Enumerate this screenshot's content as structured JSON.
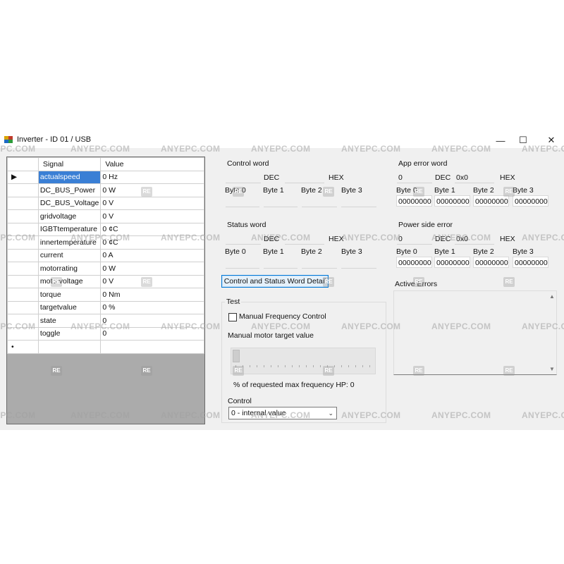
{
  "window": {
    "title": "Inverter - ID 01 / USB",
    "controls": {
      "minimize": "—",
      "maximize": "☐",
      "close": "✕"
    }
  },
  "grid": {
    "headers": {
      "signal": "Signal",
      "value": "Value"
    },
    "rows": [
      {
        "signal": "actualspeed",
        "value": "0 Hz"
      },
      {
        "signal": "DC_BUS_Power",
        "value": "0 W"
      },
      {
        "signal": "DC_BUS_Voltage",
        "value": "0 V"
      },
      {
        "signal": "gridvoltage",
        "value": "0 V"
      },
      {
        "signal": "IGBTtemperature",
        "value": "0 ¢C"
      },
      {
        "signal": "innertemperature",
        "value": "0 ¢C"
      },
      {
        "signal": "current",
        "value": "0 A"
      },
      {
        "signal": "motorrating",
        "value": "0 W"
      },
      {
        "signal": "motorvoltage",
        "value": "0 V"
      },
      {
        "signal": "torque",
        "value": "0 Nm"
      },
      {
        "signal": "targetvalue",
        "value": "0 %"
      },
      {
        "signal": "state",
        "value": "0"
      },
      {
        "signal": "toggle",
        "value": "0"
      }
    ],
    "current_row_marker": "▶",
    "new_row_marker": "•"
  },
  "control_word": {
    "title": "Control word",
    "dec_label": "DEC",
    "hex_label": "HEX",
    "dec_value": "",
    "hex_value": "",
    "byte_labels": [
      "Byte 0",
      "Byte 1",
      "Byte 2",
      "Byte 3"
    ],
    "byte_values": [
      "",
      "",
      "",
      ""
    ]
  },
  "status_word": {
    "title": "Status word",
    "dec_label": "DEC",
    "hex_label": "HEX",
    "dec_value": "",
    "hex_value": "",
    "byte_labels": [
      "Byte 0",
      "Byte 1",
      "Byte 2",
      "Byte 3"
    ],
    "byte_values": [
      "",
      "",
      "",
      ""
    ]
  },
  "app_error_word": {
    "title": "App error word",
    "dec_label": "DEC",
    "hex_label": "HEX",
    "dec_value": "0",
    "hex_value": "0x0",
    "byte_labels": [
      "Byte 0",
      "Byte 1",
      "Byte 2",
      "Byte 3"
    ],
    "byte_values": [
      "00000000",
      "00000000",
      "00000000",
      "00000000"
    ]
  },
  "power_side_error": {
    "title": "Power side error",
    "dec_label": "DEC",
    "hex_label": "HEX",
    "dec_value": "0",
    "hex_value": "0x0",
    "byte_labels": [
      "Byte 0",
      "Byte 1",
      "Byte 2",
      "Byte 3"
    ],
    "byte_values": [
      "00000000",
      "00000000",
      "00000000",
      "00000000"
    ]
  },
  "detail_button": {
    "label": "Control and Status Word Detail"
  },
  "active_errors": {
    "title": "Active Errors",
    "scroll_up": "▲",
    "scroll_down": "▼"
  },
  "test": {
    "title": "Test",
    "manual_frequency_label": "Manual Frequency Control",
    "manual_frequency_checked": false,
    "target_label": "Manual motor target value",
    "slider_value_fraction": 0,
    "percent_label": "% of requested max frequency HP: 0",
    "control_label": "Control",
    "control_selected": "0 - internal value",
    "control_arrow": "⌄"
  },
  "watermark": {
    "text": "ANYEPC.COM",
    "badge": "RE"
  }
}
